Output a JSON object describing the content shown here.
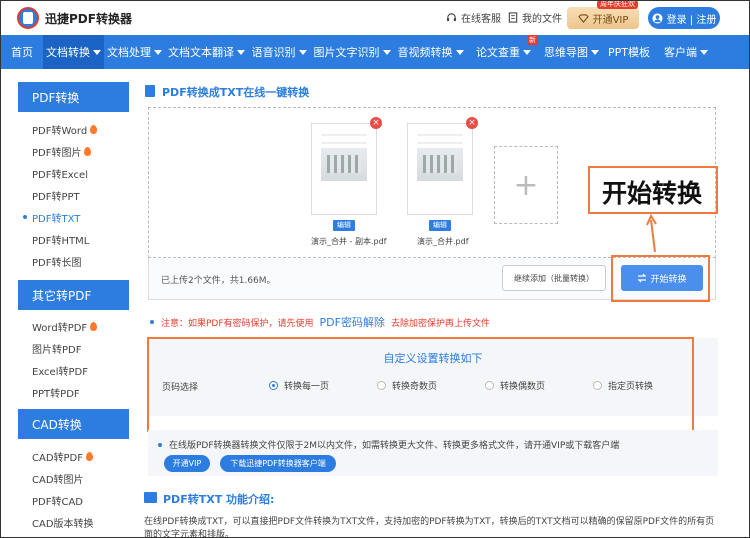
{
  "header": {
    "app_name": "迅捷PDF转换器",
    "service_link": "在线客服",
    "files_link": "我的文件",
    "vip_button": "开通VIP",
    "vip_badge": "周年庆狂欢",
    "login_button": "登录 | 注册"
  },
  "nav": {
    "items": [
      {
        "label": "首页",
        "caret": false
      },
      {
        "label": "文档转换",
        "caret": true,
        "active": true
      },
      {
        "label": "文档处理",
        "caret": true
      },
      {
        "label": "文档文本翻译",
        "caret": true
      },
      {
        "label": "语音识别",
        "caret": true
      },
      {
        "label": "图片文字识别",
        "caret": true
      },
      {
        "label": "音视频转换",
        "caret": true
      },
      {
        "label": "论文查重",
        "caret": true,
        "tag": "新"
      },
      {
        "label": "思维导图",
        "caret": true
      },
      {
        "label": "PPT模板",
        "caret": false
      },
      {
        "label": "客户端",
        "caret": true
      }
    ]
  },
  "sidebar": {
    "sections": [
      {
        "title": "PDF转换",
        "items": [
          {
            "label": "PDF转Word",
            "hot": true
          },
          {
            "label": "PDF转图片",
            "hot": true
          },
          {
            "label": "PDF转Excel"
          },
          {
            "label": "PDF转PPT"
          },
          {
            "label": "PDF转TXT",
            "active": true
          },
          {
            "label": "PDF转HTML"
          },
          {
            "label": "PDF转长图"
          }
        ]
      },
      {
        "title": "其它转PDF",
        "items": [
          {
            "label": "Word转PDF",
            "hot": true
          },
          {
            "label": "图片转PDF"
          },
          {
            "label": "Excel转PDF"
          },
          {
            "label": "PPT转PDF"
          }
        ]
      },
      {
        "title": "CAD转换",
        "items": [
          {
            "label": "CAD转PDF",
            "hot": true
          },
          {
            "label": "CAD转图片"
          },
          {
            "label": "PDF转CAD"
          },
          {
            "label": "CAD版本转换"
          }
        ]
      }
    ]
  },
  "main": {
    "title": "PDF转换成TXT在线一键转换",
    "files": [
      {
        "name": "演示_合并 - 副本.pdf",
        "edit": "编辑"
      },
      {
        "name": "演示_合并.pdf",
        "edit": "编辑"
      }
    ],
    "add_symbol": "+",
    "upload_info": "已上传2个文件，共1.66M。",
    "continue_button": "继续添加（批量转换）",
    "start_button": "开始转换",
    "callout": "开始转换",
    "notice_prefix": "注意：如果PDF有密码保护，请先使用",
    "notice_link": "PDF密码解除",
    "notice_suffix": "去除加密保护再上传文件",
    "settings_title": "自定义设置转换如下",
    "page_label": "页码选择",
    "radio_options": [
      {
        "label": "转换每一页",
        "checked": true
      },
      {
        "label": "转换奇数页",
        "checked": false
      },
      {
        "label": "转换偶数页",
        "checked": false
      },
      {
        "label": "指定页转换",
        "checked": false
      }
    ],
    "info_text": "在线版PDF转换器转换文件仅限于2M以内文件，如需转换更大文件、转换更多格式文件，请开通VIP或下载客户端",
    "vip_small_button": "开通VIP",
    "download_button": "下载迅捷PDF转换器客户端",
    "intro_title": "PDF转TXT 功能介绍:",
    "intro_text": "在线PDF转换成TXT，可以直接把PDF文件转换为TXT文件，支持加密的PDF转换为TXT，转换后的TXT文档可以精确的保留原PDF文件的所有页面的文字元素和排版。"
  },
  "colors": {
    "brand_blue": "#2d7de0",
    "highlight_orange": "#f07a3c",
    "notice_red": "#e93a2c"
  }
}
